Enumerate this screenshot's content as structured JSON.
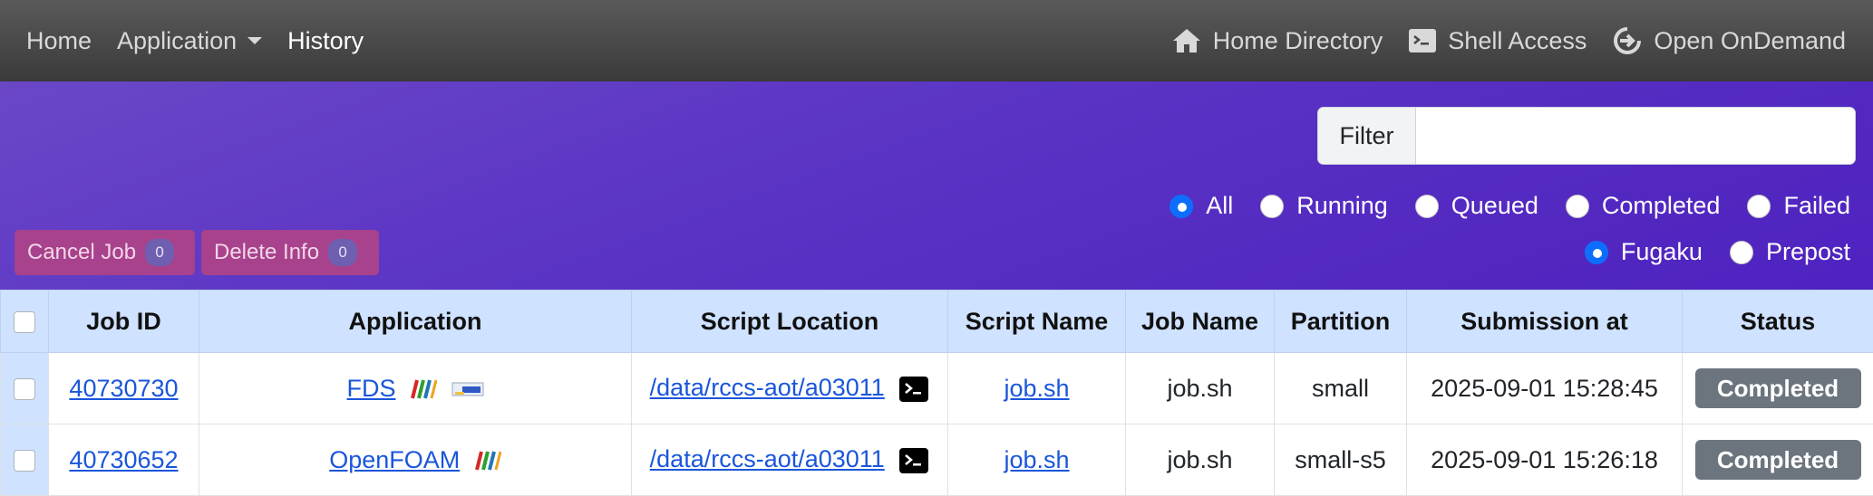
{
  "nav": {
    "left": [
      {
        "label": "Home"
      },
      {
        "label": "Application"
      },
      {
        "label": "History"
      }
    ],
    "right": [
      {
        "label": "Home Directory",
        "icon": "home-icon"
      },
      {
        "label": "Shell Access",
        "icon": "terminal-icon"
      },
      {
        "label": "Open OnDemand",
        "icon": "sign-out-icon"
      }
    ]
  },
  "filter": {
    "label": "Filter",
    "value": "",
    "placeholder": ""
  },
  "status_filters": [
    {
      "label": "All",
      "checked": true
    },
    {
      "label": "Running",
      "checked": false
    },
    {
      "label": "Queued",
      "checked": false
    },
    {
      "label": "Completed",
      "checked": false
    },
    {
      "label": "Failed",
      "checked": false
    }
  ],
  "cluster_filters": [
    {
      "label": "Fugaku",
      "checked": true
    },
    {
      "label": "Prepost",
      "checked": false
    }
  ],
  "actions": {
    "cancel": {
      "label": "Cancel Job",
      "count": "0"
    },
    "delete": {
      "label": "Delete Info",
      "count": "0"
    }
  },
  "table": {
    "headers": [
      "Job ID",
      "Application",
      "Script Location",
      "Script Name",
      "Job Name",
      "Partition",
      "Submission at",
      "Status"
    ],
    "rows": [
      {
        "job_id": "40730730",
        "application": "FDS",
        "script_location": "/data/rccs-aot/a03011",
        "script_name": "job.sh",
        "job_name": "job.sh",
        "partition": "small",
        "submitted": "2025-09-01 15:28:45",
        "status": "Completed"
      },
      {
        "job_id": "40730652",
        "application": "OpenFOAM",
        "script_location": "/data/rccs-aot/a03011",
        "script_name": "job.sh",
        "job_name": "job.sh",
        "partition": "small-s5",
        "submitted": "2025-09-01 15:26:18",
        "status": "Completed"
      }
    ]
  },
  "colors": {
    "navbar": "#474747",
    "hero": "#5a33c4",
    "table_header": "#cfe2ff",
    "status_completed": "#6c757d",
    "action_button": "#a8428c",
    "radio_checked": "#0d6efd"
  }
}
